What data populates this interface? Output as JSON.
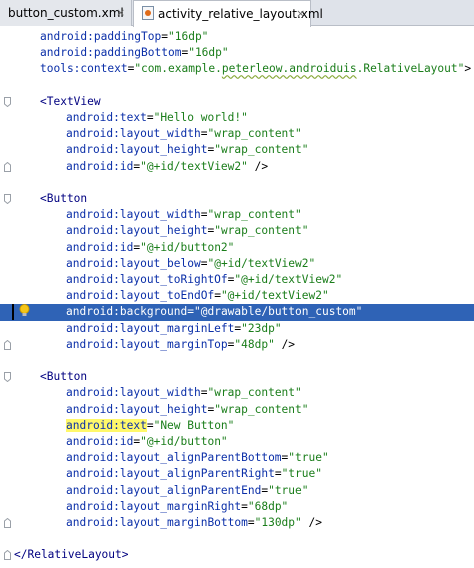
{
  "tabs": [
    {
      "label": "button_custom.xml",
      "close": "×"
    },
    {
      "label": "activity_relative_layout.xml",
      "close": "×"
    }
  ],
  "lines": [
    {
      "indent": 1,
      "attr": "android:paddingTop",
      "value": "\"16dp\"",
      "suffix": ""
    },
    {
      "indent": 1,
      "attr": "android:paddingBottom",
      "value": "\"16dp\"",
      "suffix": ""
    },
    {
      "indent": 1,
      "attr": "tools:context",
      "value": "\"com.example.peterleow.androiduis.RelativeLayout\"",
      "suffix": ">"
    },
    {
      "indent": 0,
      "text": ""
    },
    {
      "indent": 1,
      "tag": "<TextView"
    },
    {
      "indent": 2,
      "attr": "android:text",
      "value": "\"Hello world!\"",
      "suffix": ""
    },
    {
      "indent": 2,
      "attr": "android:layout_width",
      "value": "\"wrap_content\"",
      "suffix": ""
    },
    {
      "indent": 2,
      "attr": "android:layout_height",
      "value": "\"wrap_content\"",
      "suffix": ""
    },
    {
      "indent": 2,
      "attr": "android:id",
      "value": "\"@+id/textView2\"",
      "suffix": " />"
    },
    {
      "indent": 0,
      "text": ""
    },
    {
      "indent": 1,
      "tag": "<Button"
    },
    {
      "indent": 2,
      "attr": "android:layout_width",
      "value": "\"wrap_content\"",
      "suffix": ""
    },
    {
      "indent": 2,
      "attr": "android:layout_height",
      "value": "\"wrap_content\"",
      "suffix": ""
    },
    {
      "indent": 2,
      "attr": "android:id",
      "value": "\"@+id/button2\"",
      "suffix": ""
    },
    {
      "indent": 2,
      "attr": "android:layout_below",
      "value": "\"@+id/textView2\"",
      "suffix": ""
    },
    {
      "indent": 2,
      "attr": "android:layout_toRightOf",
      "value": "\"@+id/textView2\"",
      "suffix": ""
    },
    {
      "indent": 2,
      "attr": "android:layout_toEndOf",
      "value": "\"@+id/textView2\"",
      "suffix": ""
    },
    {
      "indent": 2,
      "attr": "android:background",
      "value": "\"@drawable/button_custom\"",
      "suffix": "",
      "highlight": true
    },
    {
      "indent": 2,
      "attr": "android:layout_marginLeft",
      "value": "\"23dp\"",
      "suffix": ""
    },
    {
      "indent": 2,
      "attr": "android:layout_marginTop",
      "value": "\"48dp\"",
      "suffix": " />"
    },
    {
      "indent": 0,
      "text": ""
    },
    {
      "indent": 1,
      "tag": "<Button"
    },
    {
      "indent": 2,
      "attr": "android:layout_width",
      "value": "\"wrap_content\"",
      "suffix": ""
    },
    {
      "indent": 2,
      "attr": "android:layout_height",
      "value": "\"wrap_content\"",
      "suffix": ""
    },
    {
      "indent": 2,
      "attr": "android:text",
      "value": "\"New Button\"",
      "suffix": "",
      "warn": true
    },
    {
      "indent": 2,
      "attr": "android:id",
      "value": "\"@+id/button\"",
      "suffix": ""
    },
    {
      "indent": 2,
      "attr": "android:layout_alignParentBottom",
      "value": "\"true\"",
      "suffix": ""
    },
    {
      "indent": 2,
      "attr": "android:layout_alignParentRight",
      "value": "\"true\"",
      "suffix": ""
    },
    {
      "indent": 2,
      "attr": "android:layout_alignParentEnd",
      "value": "\"true\"",
      "suffix": ""
    },
    {
      "indent": 2,
      "attr": "android:layout_marginRight",
      "value": "\"68dp\"",
      "suffix": ""
    },
    {
      "indent": 2,
      "attr": "android:layout_marginBottom",
      "value": "\"130dp\"",
      "suffix": " />"
    },
    {
      "indent": 0,
      "text": ""
    },
    {
      "indent": 0,
      "tag": "</RelativeLayout>"
    }
  ],
  "colors": {
    "attribute": "#0b2fa8",
    "value": "#1a7d1a",
    "selection": "#2f63b6",
    "warning": "#fff86a"
  },
  "icons": {
    "tab_file": "xml-file-icon",
    "gutter_bulb": "lightbulb-icon",
    "fold": "fold-marker-icon"
  }
}
